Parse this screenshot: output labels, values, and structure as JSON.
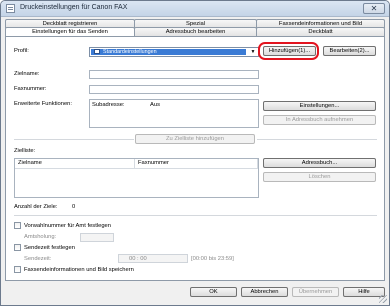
{
  "window": {
    "title": "Druckeinstellungen für Canon FAX",
    "close_glyph": "✕"
  },
  "tabs_back": [
    "Deckblatt registrieren",
    "Spezial",
    "Faxsendeinformationen und Bild"
  ],
  "tabs_front": [
    "Einstellungen für das Senden",
    "Adressbuch bearbeiten",
    "Deckblatt"
  ],
  "profile": {
    "label": "Profil:",
    "selected": "Standardeinstellungen",
    "add_button": "Hinzufügen(1)...",
    "edit_button": "Bearbeiten(2)..."
  },
  "fields": {
    "target_name_label": "Zielname:",
    "fax_number_label": "Faxnummer:",
    "extended_label": "Erweiterte Funktionen:",
    "subaddress_label": "Subadresse:",
    "subaddress_value": "Aus",
    "settings_button": "Einstellungen...",
    "add_to_addressbook_button": "In Adressbuch aufnehmen",
    "add_to_list_button": "Zu Zielliste hinzufügen"
  },
  "target_list": {
    "label": "Zielliste:",
    "columns": [
      "Zielname",
      "Faxnummer"
    ],
    "addressbook_button": "Adressbuch...",
    "delete_button": "Löschen",
    "count_label": "Anzahl der Ziele:",
    "count_value": "0"
  },
  "options": {
    "prefix_label": "Vorwahlnummer für Amt festlegen",
    "line_label": "Amtsholung:",
    "sendtime_label": "Sendezeit festlegen",
    "time_label": "Sendezeit:",
    "time_value": "00 : 00",
    "time_hint": "[00:00 bis 23:59]",
    "save_label": "Faxsendeinformationen und Bild speichern"
  },
  "footer": {
    "ok": "OK",
    "cancel": "Abbrechen",
    "apply": "Übernehmen",
    "help": "Hilfe"
  }
}
